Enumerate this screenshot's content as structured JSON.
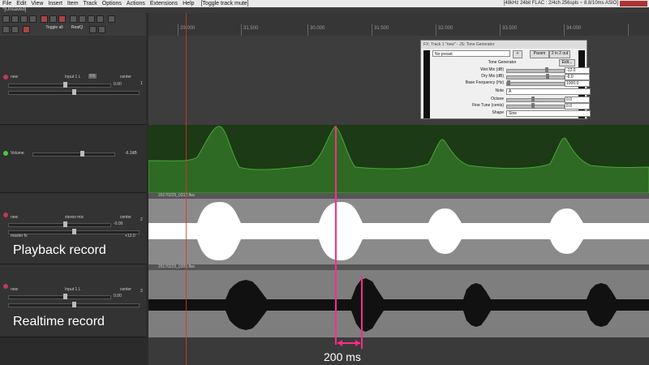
{
  "menubar": {
    "items": [
      "File",
      "Edit",
      "View",
      "Insert",
      "Item",
      "Track",
      "Options",
      "Actions",
      "Extensions",
      "Help"
    ],
    "action_text": "[Toggle track mute]",
    "status": "[48kHz 24bit FLAC : 2/4ch 256spls ~ 8.8/10ms ASIO]"
  },
  "project_tab": "*[Unsaved]",
  "toolbar": {
    "toggle_label": "Toggle all",
    "ripple_label": "RealQ",
    "icons": [
      "new-icon",
      "open-icon",
      "save-icon",
      "undo-icon",
      "redo-icon",
      "grid-icon",
      "snap-icon",
      "lock-icon"
    ]
  },
  "ruler": {
    "labels": [
      "29.000",
      "31.500",
      "30.000",
      "31.000",
      "31.500",
      "32.000",
      "33.500",
      "34.000"
    ]
  },
  "tracks": [
    {
      "name": "new",
      "input": "Input 1 L",
      "mode": "center",
      "vol_db": "0.00",
      "vol_fraction": 0.55,
      "pan_fraction": 0.5,
      "number": "1",
      "input_btn": "FX"
    },
    {
      "envelope_name": "Volume",
      "envelope_value": "-6.2dB",
      "envelope_fraction": 0.6
    },
    {
      "name": "new",
      "input": "stereo mix",
      "mode": "center",
      "vol_db": "-0.00",
      "vol_fraction": 0.55,
      "pan_fraction": 0.5,
      "number": "2",
      "sub_label": "master fx",
      "sub_value": "+12.0",
      "item_name": "20170225_0312.flac",
      "caption": "Playback record"
    },
    {
      "name": "new",
      "input": "Input 1 L",
      "mode": "center",
      "vol_db": "0.00",
      "vol_fraction": 0.55,
      "pan_fraction": 0.5,
      "number": "3",
      "item_name": "20170225_0305.flac",
      "caption": "Realtime record"
    }
  ],
  "fx_window": {
    "title": "FX: Track 1 \"new\" - JS: Tone Generator",
    "preset": "No preset",
    "buttons": [
      "+",
      "Param",
      "2 in 2 out"
    ],
    "plugin_name": "Tone Generator",
    "edit_btn": "Edit...",
    "params": [
      {
        "label": "Wet Mix (dB)",
        "value": "-12.0",
        "fraction": 0.7,
        "kind": "slider"
      },
      {
        "label": "Dry Mix (dB)",
        "value": "-6.0",
        "fraction": 0.72,
        "kind": "slider"
      },
      {
        "label": "Base Frequency (Hz)",
        "value": "1000.0",
        "fraction": 0.03,
        "kind": "slider"
      },
      {
        "label": "Note",
        "value": "A",
        "kind": "select"
      },
      {
        "label": "Octave",
        "value": "0.0",
        "fraction": 0.45,
        "kind": "slider"
      },
      {
        "label": "Fine Tune (cents)",
        "value": "0.0",
        "fraction": 0.45,
        "kind": "slider"
      },
      {
        "label": "Shape",
        "value": "Sine",
        "kind": "select"
      }
    ]
  },
  "measurement": {
    "label": "200 ms",
    "color": "#ff2b8a"
  },
  "colors": {
    "envelope": "#2e6a24",
    "playback_wave": "#ffffff",
    "realtime_wave": "#111111",
    "record": "#c13b52"
  }
}
